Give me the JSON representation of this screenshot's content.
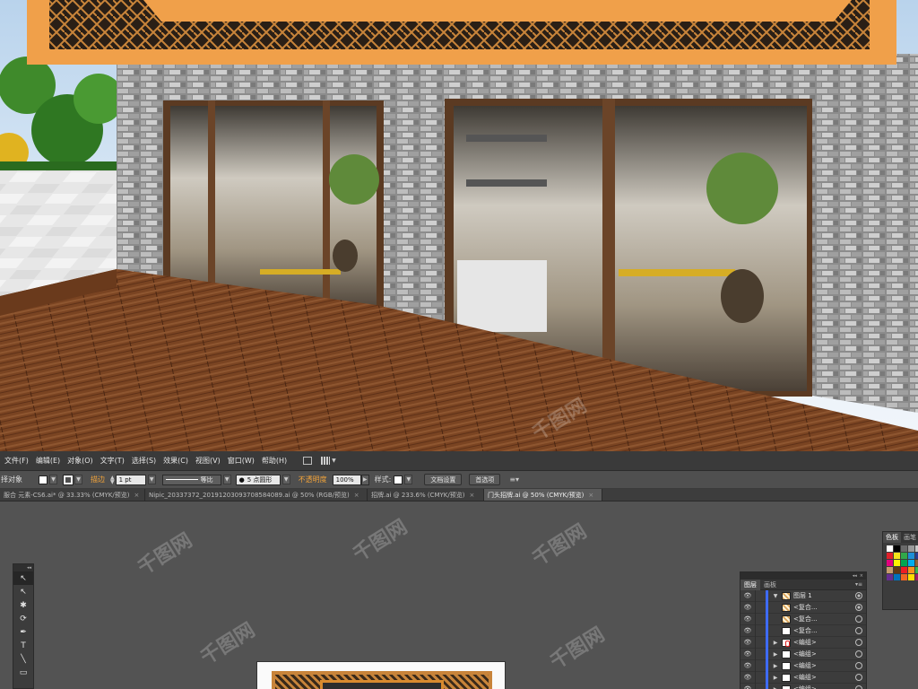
{
  "menubar": {
    "items": [
      "文件(F)",
      "编辑(E)",
      "对象(O)",
      "文字(T)",
      "选择(S)",
      "效果(C)",
      "视图(V)",
      "窗口(W)",
      "帮助(H)"
    ]
  },
  "controlbar": {
    "selection_label": "择对象",
    "stroke_label": "描边",
    "stroke_weight": "1 pt",
    "stroke_style": "等比",
    "brush": "5 点圆形",
    "opacity_label": "不透明度",
    "opacity_value": "100%",
    "style_label": "样式:",
    "doc_setup_button": "文档设置",
    "prefs_button": "首选项"
  },
  "tabs": [
    {
      "label": "服合 元素-CS6.ai* @ 33.33% (CMYK/预览)",
      "active": false
    },
    {
      "label": "Nipic_20337372_20191203093708584089.ai @ 50% (RGB/预览)",
      "active": false
    },
    {
      "label": "招牌.ai @ 233.6% (CMYK/预览)",
      "active": false
    },
    {
      "label": "门头招牌.ai @ 50% (CMYK/预览)",
      "active": true
    }
  ],
  "tab_close": "×",
  "layers_panel": {
    "tabs": [
      "图层",
      "画板"
    ],
    "rows": [
      {
        "name": "图层 1",
        "thumb": "pattern",
        "target": "filled",
        "expand": "▼"
      },
      {
        "name": "<复合...",
        "thumb": "pattern",
        "target": "filled",
        "expand": ""
      },
      {
        "name": "<复合...",
        "thumb": "pattern",
        "target": "",
        "expand": ""
      },
      {
        "name": "<复合...",
        "thumb": "plain",
        "target": "",
        "expand": ""
      },
      {
        "name": "<编组>",
        "thumb": "red",
        "target": "",
        "expand": "▶"
      },
      {
        "name": "<编组>",
        "thumb": "plain",
        "target": "",
        "expand": "▶"
      },
      {
        "name": "<编组>",
        "thumb": "plain",
        "target": "",
        "expand": "▶"
      },
      {
        "name": "<编组>",
        "thumb": "plain",
        "target": "",
        "expand": "▶"
      },
      {
        "name": "<编组>",
        "thumb": "plain",
        "target": "",
        "expand": "▶"
      }
    ]
  },
  "swatches_panel": {
    "tabs": [
      "色板",
      "画笔"
    ],
    "colors": [
      "#ffffff",
      "#000000",
      "#6a6a6a",
      "#9a9a9a",
      "#c8c8c8",
      "#e0202a",
      "#f5e21b",
      "#31a84a",
      "#1e8fd6",
      "#2a3c8f",
      "#e4007f",
      "#fff200",
      "#00a651",
      "#00aeef",
      "#8c6239",
      "#c69c6d",
      "#603913",
      "#ed1c24",
      "#f7941d",
      "#39b54a",
      "#662d91",
      "#0072bc",
      "#f26522",
      "#ffdd00",
      "#9e1f63"
    ]
  },
  "watermark": "千图网",
  "tools": [
    "↖",
    "↖",
    "✱",
    "⟳",
    "✒",
    "T",
    "╲",
    "▭"
  ]
}
